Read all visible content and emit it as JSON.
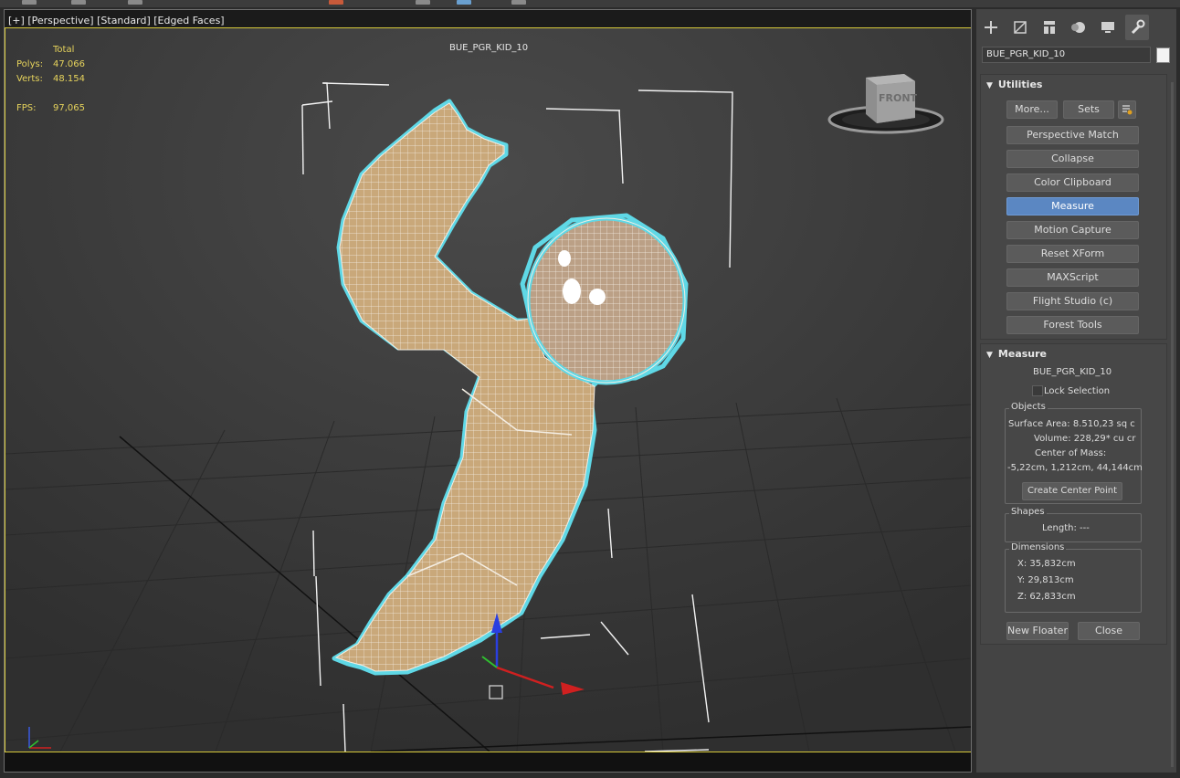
{
  "viewport": {
    "label_parts": [
      "[+]",
      "[Perspective]",
      "[Standard]",
      "[Edged Faces]"
    ],
    "object_name": "BUE_PGR_KID_10",
    "stats": {
      "header": "Total",
      "polys_label": "Polys:",
      "polys_value": "47.066",
      "verts_label": "Verts:",
      "verts_value": "48.154",
      "fps_label": "FPS:",
      "fps_value": "97,065"
    },
    "viewcube_label": "FRONT"
  },
  "panel": {
    "tabs": [
      "create-icon",
      "modify-icon",
      "hierarchy-icon",
      "motion-icon",
      "display-icon",
      "utilities-icon"
    ],
    "name_field": "BUE_PGR_KID_10",
    "utilities": {
      "title": "Utilities",
      "more_label": "More...",
      "sets_label": "Sets",
      "buttons": [
        "Perspective Match",
        "Collapse",
        "Color Clipboard",
        "Measure",
        "Motion Capture",
        "Reset XForm",
        "MAXScript",
        "Flight Studio (c)",
        "Forest Tools"
      ],
      "active_button": "Measure"
    },
    "measure": {
      "title": "Measure",
      "object_name": "BUE_PGR_KID_10",
      "lock_selection": "Lock Selection",
      "objects_title": "Objects",
      "surface_area": "Surface Area: 8.510,23 sq c",
      "volume": "Volume:  228,29* cu cr",
      "center_of_mass_label": "Center of Mass:",
      "center_of_mass_value": "-5,22cm, 1,212cm, 44,144cm",
      "create_center_point": "Create Center Point",
      "shapes_title": "Shapes",
      "length": "Length: ---",
      "dimensions_title": "Dimensions",
      "dim_x": "X:  35,832cm",
      "dim_y": "Y:  29,813cm",
      "dim_z": "Z:  62,833cm",
      "new_floater": "New Floater",
      "close": "Close"
    }
  },
  "colors": {
    "viewport_border_active": "#d6c83a",
    "stats_text": "#e6d35c",
    "selection_outline": "#5fd8e6",
    "mesh_fill": "#c8a878",
    "active_button": "#5b87c2"
  }
}
